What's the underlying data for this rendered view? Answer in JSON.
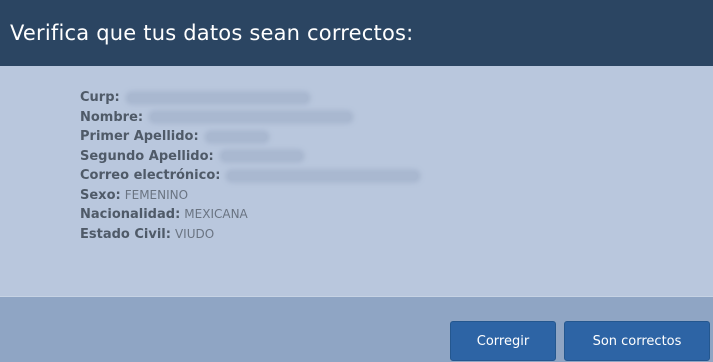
{
  "dialog": {
    "title": "Verifica que tus datos sean correctos:"
  },
  "fields": [
    {
      "label": "Curp:",
      "value": "",
      "redacted": true,
      "blur_width": 180
    },
    {
      "label": "Nombre:",
      "value": "",
      "redacted": true,
      "blur_width": 200
    },
    {
      "label": "Primer Apellido:",
      "value": "",
      "redacted": true,
      "blur_width": 60
    },
    {
      "label": "Segundo Apellido:",
      "value": "",
      "redacted": true,
      "blur_width": 80
    },
    {
      "label": "Correo electrónico:",
      "value": "",
      "redacted": true,
      "blur_width": 190
    },
    {
      "label": "Sexo:",
      "value": "FEMENINO",
      "redacted": false
    },
    {
      "label": "Nacionalidad:",
      "value": "MEXICANA",
      "redacted": false
    },
    {
      "label": "Estado Civil:",
      "value": "VIUDO",
      "redacted": false
    }
  ],
  "buttons": {
    "corregir": "Corregir",
    "correctos": "Son correctos"
  },
  "colors": {
    "header_bg": "#2b4562",
    "body_bg": "#b9c7dd",
    "footer_bg": "#8fa5c4",
    "button_bg": "#2d64a5"
  }
}
